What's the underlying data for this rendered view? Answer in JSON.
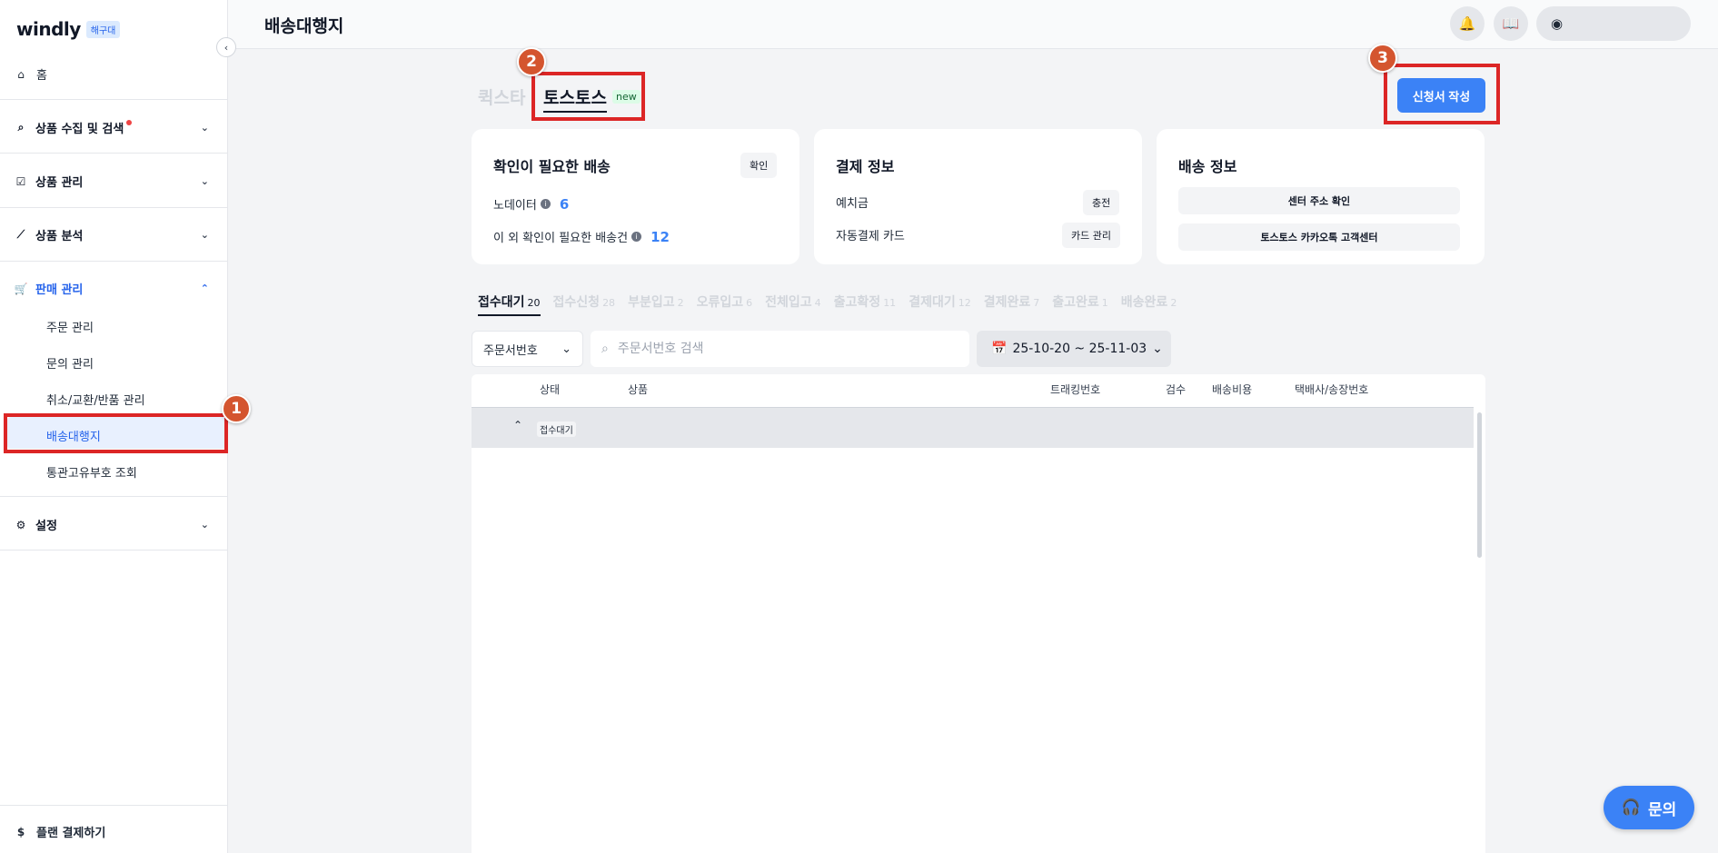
{
  "brand": {
    "logo": "windly",
    "badge": "해구대"
  },
  "sidebar": {
    "home": "홈",
    "groups": {
      "collect": "상품 수집 및 검색",
      "manage": "상품 관리",
      "analysis": "상품 분석",
      "sales": "판매 관리",
      "settings": "설정"
    },
    "sales_items": [
      "주문 관리",
      "문의 관리",
      "취소/교환/반품 관리",
      "배송대행지",
      "통관고유부호 조회"
    ],
    "plan": "플랜 결제하기"
  },
  "header": {
    "title": "배송대행지"
  },
  "tabs": {
    "quick": "퀵스타",
    "toss": "토스토스",
    "new_badge": "new"
  },
  "apply_button": "신청서 작성",
  "callouts": [
    "1",
    "2",
    "3"
  ],
  "cards": {
    "confirm": {
      "title": "확인이 필요한 배송",
      "button": "확인",
      "row1_label": "노데이터",
      "row1_value": "6",
      "row2_label": "이 외 확인이 필요한 배송건",
      "row2_value": "12"
    },
    "payment": {
      "title": "결제 정보",
      "row1_label": "예치금",
      "row1_button": "충전",
      "row2_label": "자동결제 카드",
      "row2_button": "카드 관리"
    },
    "shipping": {
      "title": "배송 정보",
      "button1": "센터 주소 확인",
      "button2": "토스토스 카카오톡 고객센터"
    }
  },
  "status_tabs": [
    {
      "label": "접수대기",
      "count": "20"
    },
    {
      "label": "접수신청",
      "count": "28"
    },
    {
      "label": "부분입고",
      "count": "2"
    },
    {
      "label": "오류입고",
      "count": "6"
    },
    {
      "label": "전체입고",
      "count": "4"
    },
    {
      "label": "출고확정",
      "count": "11"
    },
    {
      "label": "결제대기",
      "count": "12"
    },
    {
      "label": "결제완료",
      "count": "7"
    },
    {
      "label": "출고완료",
      "count": "1"
    },
    {
      "label": "배송완료",
      "count": "2"
    }
  ],
  "filters": {
    "select_value": "주문서번호",
    "search_placeholder": "주문서번호 검색",
    "date_range": "25-10-20 ~ 25-11-03"
  },
  "table": {
    "headers": {
      "status": "상태",
      "product": "상품",
      "tracking": "트래킹번호",
      "inspection": "검수",
      "shipping_cost": "배송비용",
      "courier": "택배사/송장번호"
    },
    "group_label": "접수대기"
  },
  "help_button": "문의"
}
